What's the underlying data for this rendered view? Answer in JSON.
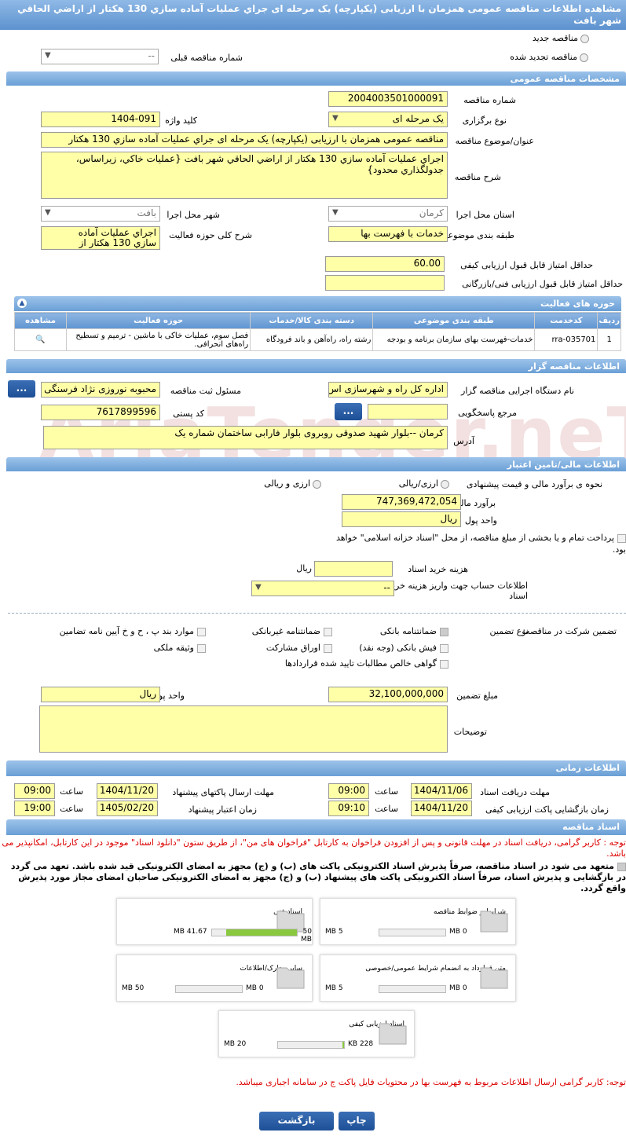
{
  "title": "مشاهده اطلاعات مناقصه عمومی همزمان با ارزیابی (یکپارچه) یک مرحله ای جراي عمليات آماده سازي 130 هکتار از اراضي الحاقي شهر بافت",
  "top": {
    "new_tender": "مناقصه جدید",
    "renewed_tender": "مناقصه تجدید شده",
    "prev_tender_label": "شماره مناقصه قبلی",
    "prev_tender_value": "--"
  },
  "general": {
    "header": "مشخصات مناقصه عمومی",
    "number_label": "شماره مناقصه",
    "number": "2004003501000091",
    "type_label": "نوع برگزاری",
    "type": "یک مرحله ای",
    "keyword_label": "کلید واژه",
    "keyword": "1404-091",
    "subject_label": "عنوان/موضوع مناقصه",
    "subject": "مناقصه عمومی همزمان با ارزیابی (یکپارچه) یک مرحله ای جراي عمليات آماده سازي 130 هکتار",
    "desc_label": "شرح مناقصه",
    "desc": "اجراي عمليات آماده سازي 130 هکتار از اراضي الحاقي شهر بافت {عمليات خاکي، زيراساس، جدولگذاري محدود}",
    "province_label": "استان محل اجرا",
    "province": "کرمان",
    "city_label": "شهر محل اجرا",
    "city": "بافت",
    "category_label": "طبقه بندی موضوعی",
    "category": "خدمات با فهرست بها",
    "scope_label": "شرح کلی حوزه فعالیت",
    "scope": "اجراي عمليات آماده سازي 130 هکتار از اراضي الحاقي",
    "min_quality_label": "حداقل امتیاز قابل قبول ارزیابی کیفی",
    "min_quality": "60.00",
    "min_tech_label": "حداقل امتیاز قابل قبول ارزیابی فنی/بازرگانی",
    "min_tech": ""
  },
  "activities": {
    "header": "حوزه های فعالیت",
    "columns": [
      "ردیف",
      "کدخدمت",
      "طبقه بندی موضوعی",
      "دسته بندی کالا/خدمات",
      "حوزه فعالیت",
      "مشاهده"
    ],
    "rows": [
      {
        "row": "1",
        "code": "rra-035701",
        "category": "خدمات-فهرست بهای سازمان برنامه و بودجه",
        "group": "رشته راه، راه‌آهن و باند فرودگاه",
        "field": "فصل سوم، عملیات خاکی با ماشین - ترمیم و تسطیح راه‌های انحرافی."
      }
    ]
  },
  "organizer": {
    "header": "اطلاعات مناقصه گزار",
    "org_label": "نام دستگاه اجرایی مناقصه گزار",
    "org": "اداره کل راه و شهرسازی اس",
    "registrar_label": "مسئول ثبت مناقصه",
    "registrar": "محبوبه نوروزی نژاد فرسنگی",
    "ref_label": "مرجع پاسخگویی",
    "ref": "",
    "postal_label": "کد پستی",
    "postal": "7617899596",
    "address_label": "آدرس",
    "address": "کرمان --بلوار شهید صدوقی روبروی بلوار فارابی ساختمان شماره یک",
    "btn": "..."
  },
  "finance": {
    "header": "اطلاعات مالی/تامین اعتبار",
    "estimate_type_label": "نحوه ی برآورد مالی و قیمت پیشنهادی",
    "opt1": "ارزی/ریالی",
    "opt2": "ارزی و ریالی",
    "estimate_label": "برآورد مالی",
    "estimate": "747,369,472,054",
    "currency_label": "واحد پول",
    "currency": "ریال",
    "treasury_text": "پرداخت تمام و یا بخشی از مبلغ مناقصه، از محل \"اسناد خزانه اسلامی\" خواهد بود.",
    "doc_cost_label": "هزینه خرید اسناد",
    "doc_cost_unit": "ریال",
    "account_label": "اطلاعات حساب جهت واریز هزینه خرید اسناد",
    "account_value": "--"
  },
  "guarantee": {
    "label": "تضمین شرکت در مناقصه:",
    "type_label": "نوع تضمین",
    "options": [
      "ضمانتنامه بانکی",
      "ضمانتنامه غیربانکی",
      "موارد بند پ ، ح و خ آیین نامه تضامین",
      "فیش بانکی (وجه نقد)",
      "اوراق مشارکت",
      "وثیقه ملکی",
      "گواهی خالص مطالبات تایید شده قراردادها"
    ],
    "amount_label": "مبلغ تضمین",
    "amount": "32,100,000,000",
    "unit_label": "واحد پول",
    "unit": "ریال",
    "notes_label": "توضیحات"
  },
  "timing": {
    "header": "اطلاعات زمانی",
    "recv_label": "مهلت دریافت اسناد",
    "recv_date": "1404/11/06",
    "recv_time": "09:00",
    "send_label": "مهلت ارسال پاکتهای پیشنهاد",
    "send_date": "1404/11/20",
    "send_time": "09:00",
    "open_label": "زمان بازگشایی پاکت ارزیابی کیفی",
    "open_date": "1404/11/20",
    "open_time": "09:10",
    "valid_label": "زمان اعتبار پیشنهاد",
    "valid_date": "1405/02/20",
    "valid_time": "19:00",
    "time_label": "ساعت"
  },
  "docs": {
    "header": "اسناد مناقصه",
    "notice": "توجه : کاربر گرامی، دریافت اسناد در مهلت قانونی و پس از افزودن فراخوان به کارتابل \"فراخوان های من\"، از طریق ستون \"دانلود اسناد\" موجود در این کارتابل، امکانپذیر می باشد.",
    "commit": "متعهد می شود در اسناد مناقصه، صرفاً پذیرش اسناد الکترونیکی پاکت های (ب) و (ج) مجهز به امضای الکترونیکی قید شده باشد. تعهد می گردد در بازگشایی و پذیرش اسناد، صرفاً اسناد الکترونیکی پاکت های پیشنهاد (ب) و (ج) مجهز به امضای الکترونیکی صاحبان امضای مجاز مورد پذیرش واقع گردد.",
    "files": [
      {
        "name": "شرایط و ضوابط مناقصه",
        "current": "0 MB",
        "max": "5 MB",
        "fill": 0
      },
      {
        "name": "اسناد فنی",
        "current": "41.67 MB",
        "max": "50 MB",
        "fill": 0.83
      },
      {
        "name": "متن قرارداد به انضمام شرایط عمومی/خصوصی",
        "current": "0 MB",
        "max": "5 MB",
        "fill": 0
      },
      {
        "name": "سایر مدارک/اطلاعات",
        "current": "0 MB",
        "max": "50 MB",
        "fill": 0
      },
      {
        "name": "اسناد ارزیابی کیفی",
        "current": "228 KB",
        "max": "20 MB",
        "fill": 0.02
      }
    ],
    "footer_note": "توجه: کاربر گرامی ارسال اطلاعات مربوط به فهرست بها در محتویات فایل پاکت ج در سامانه اجباری میباشد."
  },
  "buttons": {
    "print": "چاپ",
    "back": "بازگشت"
  },
  "watermark": "AriaTender.neT"
}
